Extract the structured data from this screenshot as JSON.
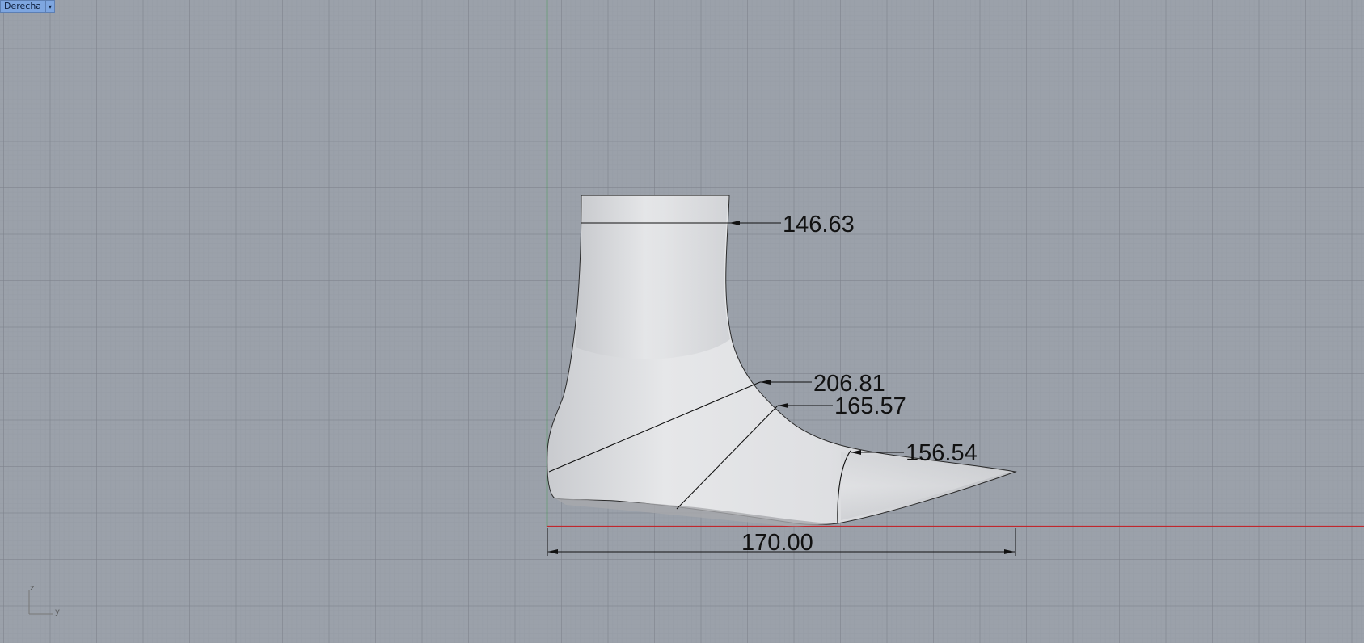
{
  "viewport": {
    "name": "Derecha",
    "colors": {
      "background": "#9ba1aa",
      "x_axis": "#c0272d",
      "y_axis": "#1a9b2b",
      "tab": "#7ea6e0"
    }
  },
  "dimensions": {
    "ankle_girth": "146.63",
    "instep_girth": "206.81",
    "waist_girth": "165.57",
    "ball_girth": "156.54",
    "length": "170.00"
  },
  "axis_widget": {
    "vertical": "z",
    "horizontal": "y"
  }
}
